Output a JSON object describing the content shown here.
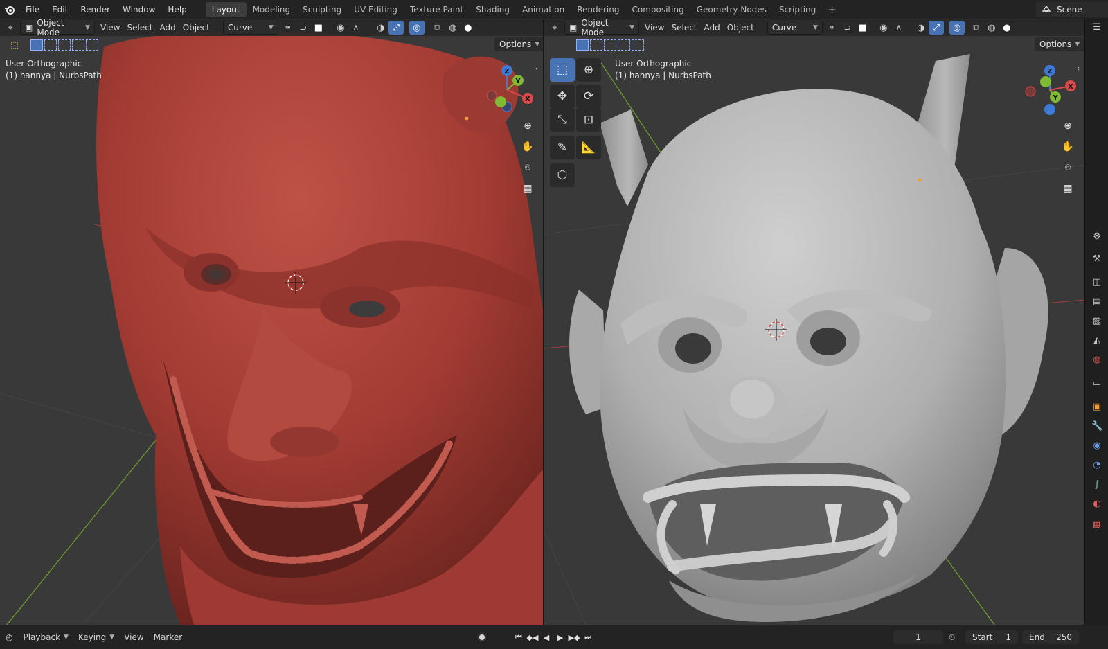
{
  "menubar": {
    "items": [
      "File",
      "Edit",
      "Render",
      "Window",
      "Help"
    ]
  },
  "workspaces": {
    "tabs": [
      "Layout",
      "Modeling",
      "Sculpting",
      "UV Editing",
      "Texture Paint",
      "Shading",
      "Animation",
      "Rendering",
      "Compositing",
      "Geometry Nodes",
      "Scripting"
    ],
    "active": "Layout"
  },
  "scene": {
    "label": "Scene"
  },
  "viewport_left": {
    "mode": "Object Mode",
    "menus": [
      "View",
      "Select",
      "Add",
      "Object"
    ],
    "transform_orientation": "Curve",
    "options_label": "Options",
    "view_name": "User Orthographic",
    "object_info": "(1) hannya | NurbsPath",
    "gizmo": {
      "x": "X",
      "y": "Y",
      "z": "Z"
    },
    "mesh_color": "#a8413a"
  },
  "viewport_right": {
    "mode": "Object Mode",
    "menus": [
      "View",
      "Select",
      "Add",
      "Object"
    ],
    "transform_orientation": "Curve",
    "options_label": "Options",
    "view_name": "User Orthographic",
    "object_info": "(1) hannya | NurbsPath",
    "gizmo": {
      "x": "X",
      "y": "Y",
      "z": "Z"
    },
    "mesh_color": "#b9b9b9",
    "tools": [
      "select-box-icon",
      "cursor-icon",
      "move-icon",
      "rotate-icon",
      "scale-icon",
      "transform-icon",
      "annotate-icon",
      "measure-icon",
      "add-cube-icon"
    ]
  },
  "timeline": {
    "menus": [
      "Playback",
      "Keying",
      "View",
      "Marker"
    ],
    "current_frame": "1",
    "start_label": "Start",
    "start_value": "1",
    "end_label": "End",
    "end_value": "250"
  },
  "colors": {
    "accent_blue": "#4772b3",
    "axis_x": "#d94a4a",
    "axis_y": "#7fba32",
    "axis_z": "#3d7bd6"
  }
}
